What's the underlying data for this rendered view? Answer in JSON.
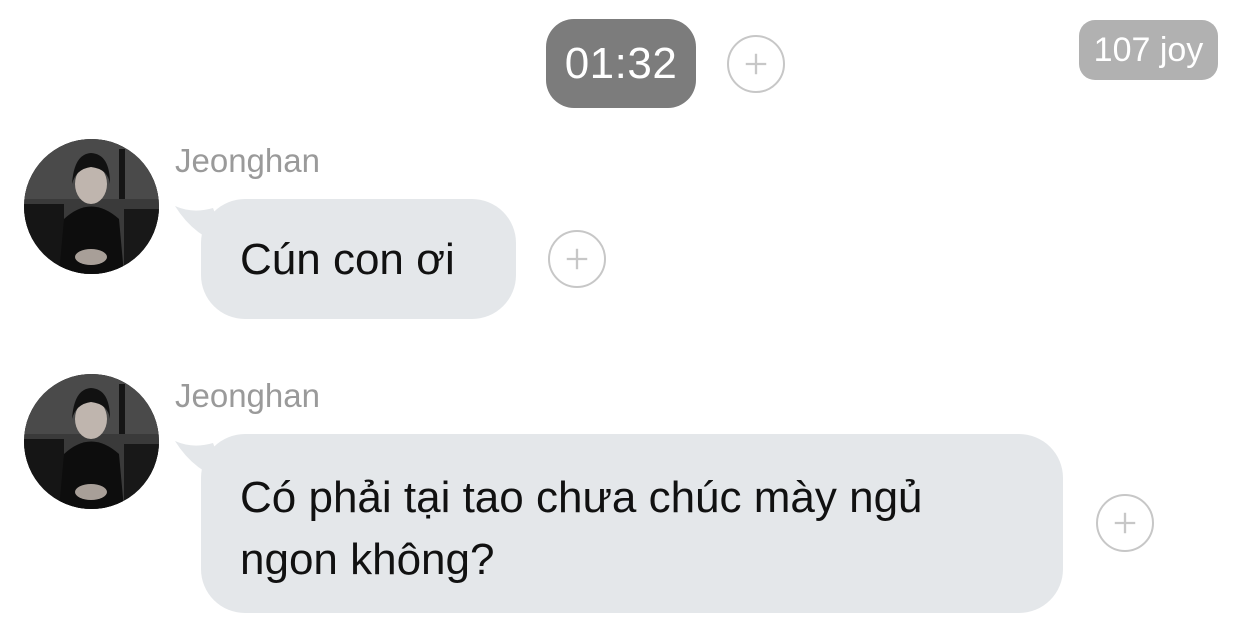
{
  "header": {
    "time": "01:32",
    "counter_badge": "107 joy"
  },
  "messages": [
    {
      "sender": "Jeonghan",
      "text": "Cún con ơi"
    },
    {
      "sender": "Jeonghan",
      "text_lines": [
        "Có phải tại tao chưa chúc mày ngủ",
        "ngon không?"
      ]
    }
  ],
  "icons": {
    "add": "plus-circle-icon",
    "avatar": "profile-photo"
  },
  "colors": {
    "time_pill": "#7c7c7c",
    "badge": "#b1b1b1",
    "bubble": "#e4e7ea",
    "sender_name": "#9a9a9a",
    "plus_outline": "#c7c7c7"
  }
}
